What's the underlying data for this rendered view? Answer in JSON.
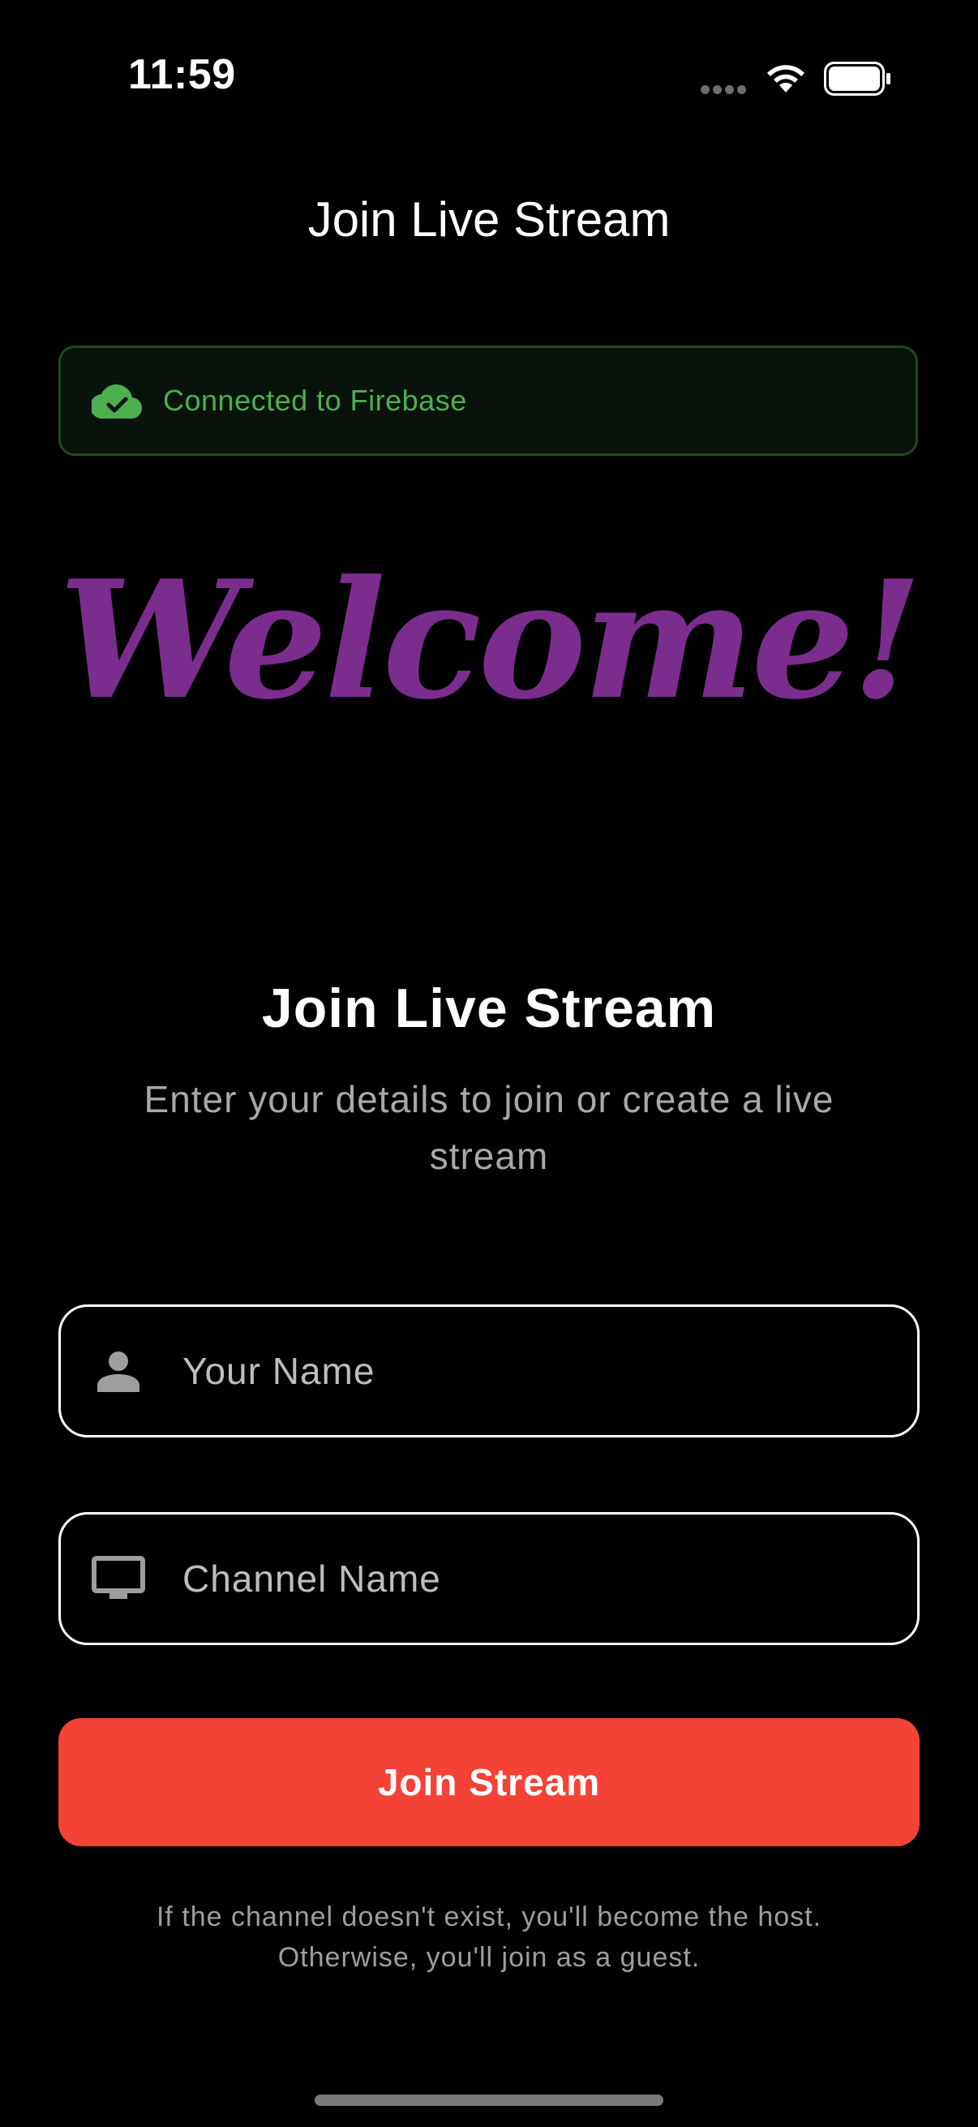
{
  "status_bar": {
    "time": "11:59"
  },
  "nav": {
    "title": "Join Live Stream"
  },
  "connection_banner": {
    "text": "Connected to Firebase",
    "icon": "cloud-done-icon",
    "color": "#4caf50"
  },
  "welcome": {
    "text": "Welcome!",
    "color": "#7b2d8e"
  },
  "main": {
    "headline": "Join Live Stream",
    "subtitle": "Enter your details to join or create a live stream"
  },
  "form": {
    "name_field": {
      "placeholder": "Your Name",
      "value": "",
      "icon": "person-icon"
    },
    "channel_field": {
      "placeholder": "Channel Name",
      "value": "",
      "icon": "tv-icon"
    },
    "submit_label": "Join Stream",
    "submit_color": "#f44336"
  },
  "hint": {
    "line1": "If the channel doesn't exist, you'll become the host.",
    "line2": "Otherwise, you'll join as a guest."
  }
}
